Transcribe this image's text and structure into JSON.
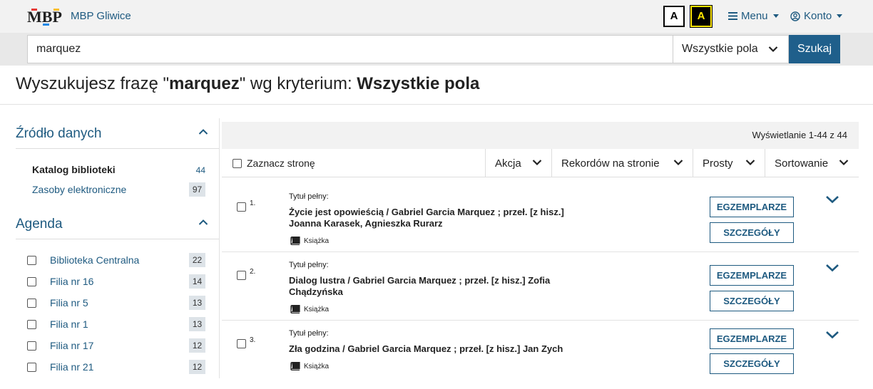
{
  "header": {
    "brand": "MBP Gliwice",
    "logo_text": "MBP",
    "contrast_normal": "A",
    "contrast_high": "A",
    "menu_label": "Menu",
    "account_label": "Konto"
  },
  "search": {
    "query": "marquez",
    "scope": "Wszystkie pola",
    "button": "Szukaj"
  },
  "heading": {
    "prefix": "Wyszukujesz frazę \"",
    "phrase": "marquez",
    "middle": "\" wg kryterium: ",
    "criterion": "Wszystkie pola"
  },
  "sidebar": {
    "source": {
      "title": "Źródło danych",
      "items": [
        {
          "label": "Katalog biblioteki",
          "count": "44"
        },
        {
          "label": "Zasoby elektroniczne",
          "count": "97"
        }
      ]
    },
    "agenda": {
      "title": "Agenda",
      "items": [
        {
          "label": "Biblioteka Centralna",
          "count": "22"
        },
        {
          "label": "Filia nr 16",
          "count": "14"
        },
        {
          "label": "Filia nr 5",
          "count": "13"
        },
        {
          "label": "Filia nr 1",
          "count": "13"
        },
        {
          "label": "Filia nr 17",
          "count": "12"
        },
        {
          "label": "Filia nr 21",
          "count": "12"
        }
      ]
    }
  },
  "results": {
    "summary": "Wyświetlanie 1-44 z 44",
    "toolbar": {
      "select_page": "Zaznacz stronę",
      "action": "Akcja",
      "per_page": "Rekordów na stronie",
      "view": "Prosty",
      "sort": "Sortowanie"
    },
    "items": [
      {
        "num": "1.",
        "label": "Tytuł pełny:",
        "title": "Życie jest opowieścią / Gabriel Garcia Marquez ; przeł. [z hisz.] Joanna Karasek, Agnieszka Rurarz",
        "type": "Książka",
        "btn_copies": "EGZEMPLARZE",
        "btn_details": "SZCZEGÓŁY"
      },
      {
        "num": "2.",
        "label": "Tytuł pełny:",
        "title": "Dialog lustra / Gabriel Garcia Marquez ; przeł. [z hisz.] Zofia Chądzyńska",
        "type": "Książka",
        "btn_copies": "EGZEMPLARZE",
        "btn_details": "SZCZEGÓŁY"
      },
      {
        "num": "3.",
        "label": "Tytuł pełny:",
        "title": "Zła godzina / Gabriel Garcia Marquez ; przeł. [z hisz.] Jan Zych",
        "type": "Książka",
        "btn_copies": "EGZEMPLARZE",
        "btn_details": "SZCZEGÓŁY"
      }
    ]
  },
  "colors": {
    "link": "#1e5a80",
    "primary_button": "#1f5f8b",
    "topbar": "#f2f2f2",
    "badge": "#dde3e8"
  }
}
